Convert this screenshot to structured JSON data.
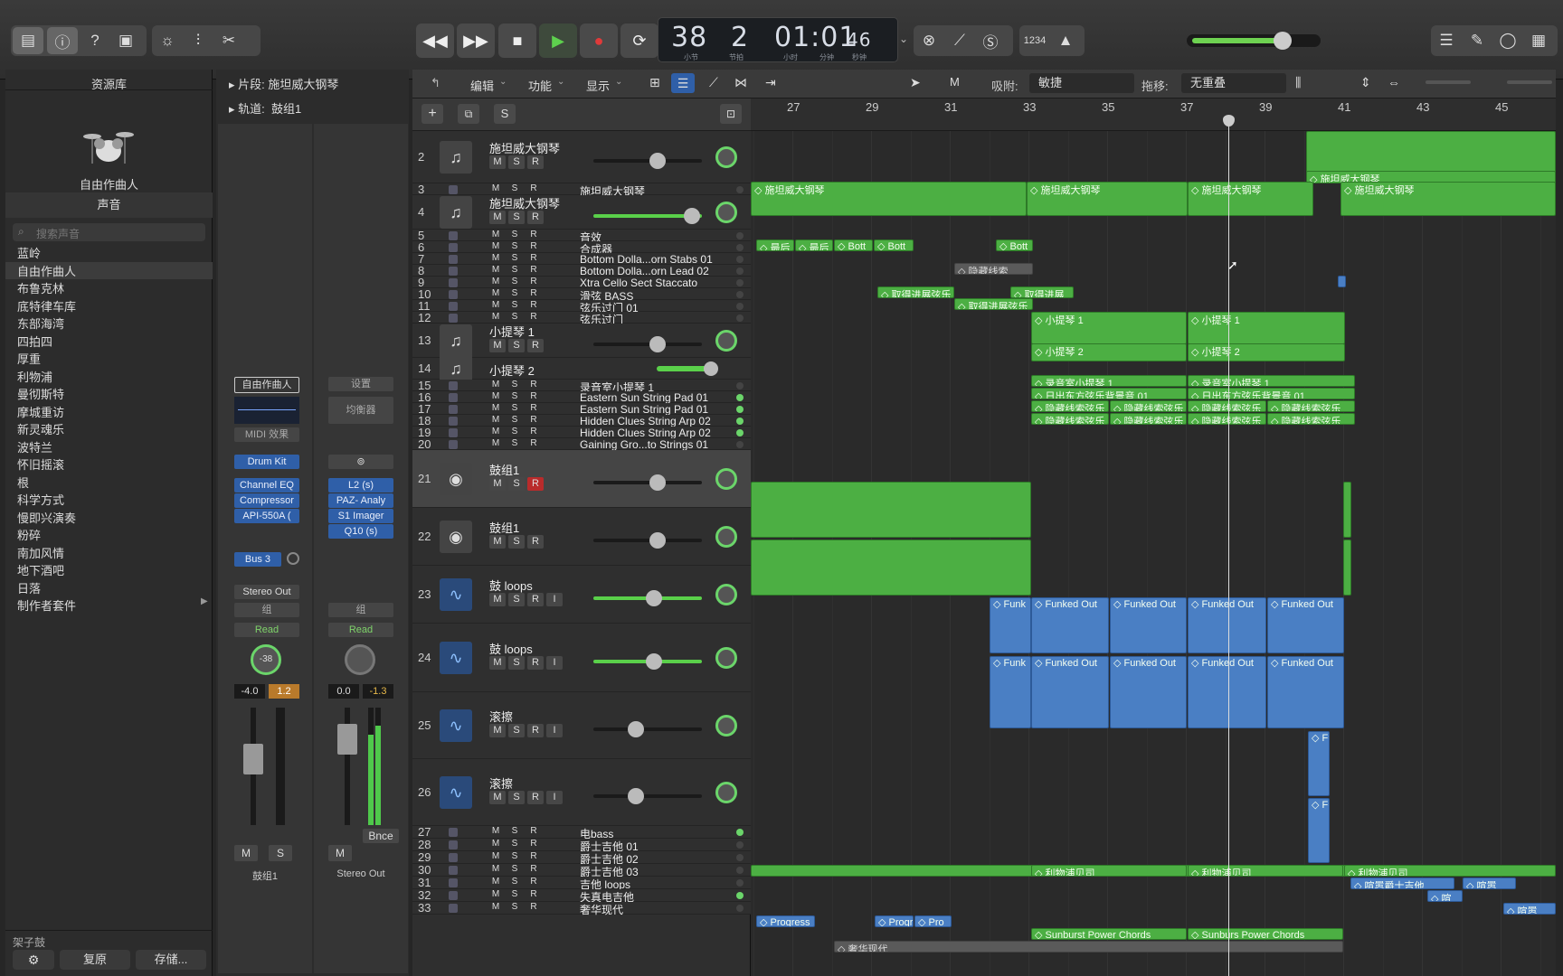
{
  "toolbar": {
    "lcd_bar": "38",
    "lcd_beat": "2",
    "lcd_time": "01:01",
    "lcd_frames": "46",
    "lcd_bar_label": "小节",
    "lcd_beat_label": "节拍",
    "lcd_hour_label": "小时",
    "lcd_min_label": "分钟",
    "lcd_sec_label": "秒钟",
    "count_in": "1234"
  },
  "library": {
    "title": "资源库",
    "patch": "自由作曲人",
    "sounds": "声音",
    "search_placeholder": "搜索声音",
    "items": [
      "蓝岭",
      "自由作曲人",
      "布鲁克林",
      "底特律车库",
      "东部海湾",
      "四拍四",
      "厚重",
      "利物浦",
      "曼彻斯特",
      "摩城重访",
      "新灵魂乐",
      "波特兰",
      "怀旧摇滚",
      "根",
      "科学方式",
      "慢即兴演奏",
      "粉碎",
      "南加风情",
      "地下酒吧",
      "日落",
      "制作者套件"
    ],
    "footer_drums": "架子鼓",
    "revert": "复原",
    "save": "存储..."
  },
  "inspector": {
    "region_label": "片段:",
    "region_value": "施坦威大钢琴",
    "track_label": "轨道:",
    "track_value": "鼓组1",
    "left": {
      "name_btn": "自由作曲人",
      "midi": "MIDI 效果",
      "instrument": "Drum Kit",
      "plugins": [
        "Channel EQ",
        "Compressor",
        "API-550A ("
      ],
      "send": "Bus 3",
      "output": "Stereo Out",
      "group": "组",
      "auto": "Read",
      "pan": "-38",
      "vol": "-4.0",
      "peak": "1.2",
      "mute": "M",
      "solo": "S",
      "strip_name": "鼓组1"
    },
    "right": {
      "setting": "设置",
      "eq": "均衡器",
      "plugins": [
        "L2 (s)",
        "PAZ- Analy",
        "S1 Imager",
        "Q10 (s)"
      ],
      "group": "组",
      "auto": "Read",
      "vol": "0.0",
      "peak": "-1.3",
      "mute": "M",
      "bnce": "Bnce",
      "strip_name": "Stereo Out"
    }
  },
  "content_toolbar": {
    "edit": "编辑",
    "functions": "功能",
    "view": "显示",
    "snap_label": "吸附:",
    "snap_value": "敏捷",
    "drag_label": "拖移:",
    "drag_value": "无重叠"
  },
  "ruler": [
    "27",
    "29",
    "31",
    "33",
    "35",
    "37",
    "39",
    "41",
    "43",
    "45"
  ],
  "tracks": [
    {
      "n": "2",
      "name": "施坦威大钢琴"
    },
    {
      "n": "3",
      "name": "施坦威大钢琴"
    },
    {
      "n": "4",
      "name": "施坦威大钢琴"
    },
    {
      "n": "5",
      "name": "音效"
    },
    {
      "n": "6",
      "name": "合成器"
    },
    {
      "n": "7",
      "name": "Bottom Dolla...orn Stabs 01"
    },
    {
      "n": "8",
      "name": "Bottom Dolla...orn Lead 02"
    },
    {
      "n": "9",
      "name": "Xtra Cello Sect Staccato"
    },
    {
      "n": "10",
      "name": "滑弦 BASS"
    },
    {
      "n": "11",
      "name": "弦乐过门 01"
    },
    {
      "n": "12",
      "name": "弦乐过门"
    },
    {
      "n": "13",
      "name": "小提琴 1"
    },
    {
      "n": "14",
      "name": "小提琴 2"
    },
    {
      "n": "15",
      "name": "录音室小提琴 1"
    },
    {
      "n": "16",
      "name": "Eastern Sun String Pad 01"
    },
    {
      "n": "17",
      "name": "Eastern Sun String Pad 01"
    },
    {
      "n": "18",
      "name": "Hidden Clues String Arp 02"
    },
    {
      "n": "19",
      "name": "Hidden Clues String Arp 02"
    },
    {
      "n": "20",
      "name": "Gaining Gro...to Strings 01"
    },
    {
      "n": "21",
      "name": "鼓组1"
    },
    {
      "n": "22",
      "name": "鼓组1"
    },
    {
      "n": "23",
      "name": "鼓 loops"
    },
    {
      "n": "24",
      "name": "鼓 loops"
    },
    {
      "n": "25",
      "name": "滚擦"
    },
    {
      "n": "26",
      "name": "滚擦"
    },
    {
      "n": "27",
      "name": "电bass"
    },
    {
      "n": "28",
      "name": "爵士吉他 01"
    },
    {
      "n": "29",
      "name": "爵士吉他 02"
    },
    {
      "n": "30",
      "name": "爵士吉他 03"
    },
    {
      "n": "31",
      "name": "吉他 loops"
    },
    {
      "n": "32",
      "name": "失真电吉他"
    },
    {
      "n": "33",
      "name": "奢华现代"
    }
  ],
  "msr": {
    "m": "M",
    "s": "S",
    "r": "R",
    "i": "I"
  },
  "regions": {
    "piano": "施坦威大钢琴",
    "bott": "Bott",
    "zuihou": "最后",
    "hidden_line": "隐藏线索",
    "progress": "取得进展弦乐",
    "progress2": "取得进展",
    "violin1": "小提琴 1",
    "violin2": "小提琴 2",
    "studio_violin": "录音室小提琴 1",
    "eastern": "日出东方弦乐背景音 01",
    "hidden_strings": "隐藏线索弦乐",
    "funked": "Funked Out",
    "funk": "Funk",
    "fun": "Fun",
    "liverpool": "利物浦贝司",
    "noisy_jazz": "喧嚣爵士吉他",
    "noisy": "喧嚣",
    "xuan": "喧",
    "prog_a": "Progress",
    "prog_b": "Progr",
    "prog_c": "Pro",
    "sunburst": "Sunburst Power Chords",
    "sunburst2": "Sunburs  Power Chords",
    "luxury": "奢华现代"
  }
}
